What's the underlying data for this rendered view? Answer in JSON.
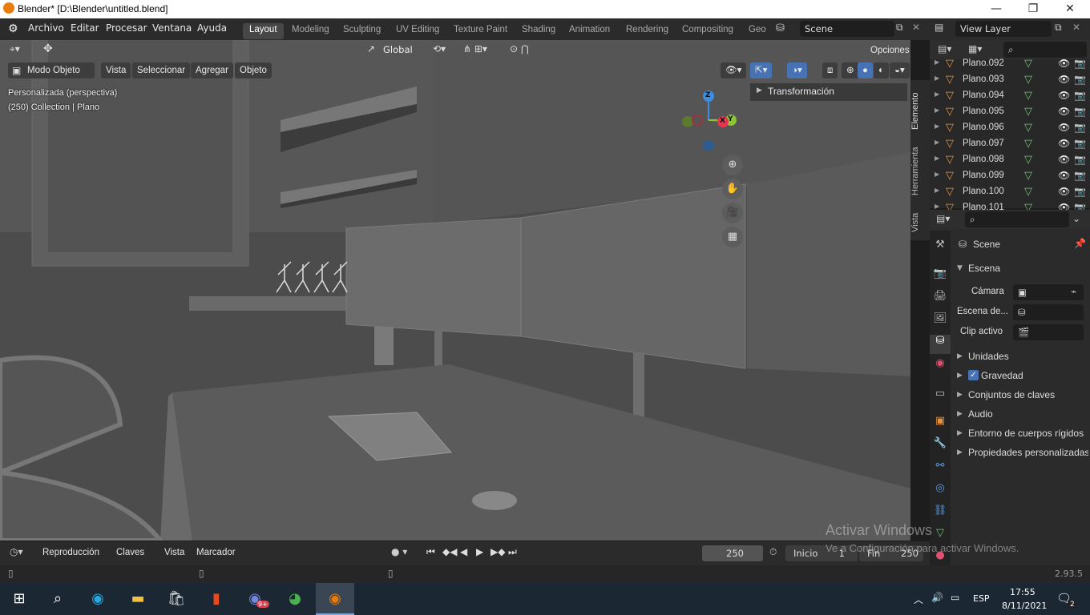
{
  "window": {
    "title": "Blender* [D:\\Blender\\untitled.blend]",
    "minimize": "—",
    "maximize": "❐",
    "close": "✕"
  },
  "menu": {
    "items": [
      "Archivo",
      "Editar",
      "Procesar",
      "Ventana",
      "Ayuda"
    ]
  },
  "workspaces": [
    "Layout",
    "Modeling",
    "Sculpting",
    "UV Editing",
    "Texture Paint",
    "Shading",
    "Animation",
    "Rendering",
    "Compositing",
    "Geo"
  ],
  "scene_field": "Scene",
  "view_layer_field": "View Layer",
  "viewport": {
    "transform_orientation": "Global",
    "options_label": "Opciones",
    "mode": "Modo Objeto",
    "header_menus": [
      "Vista",
      "Seleccionar",
      "Agregar",
      "Objeto"
    ],
    "view_name": "Personalizada (perspectiva)",
    "collection_info": "(250) Collection | Plano",
    "transform_panel": "Transformación",
    "side_tabs": [
      "Elemento",
      "Herramienta",
      "Vista"
    ],
    "gizmo": {
      "z": "Z",
      "x": "X",
      "y": "Y"
    }
  },
  "outliner": {
    "items": [
      "Plano.092",
      "Plano.093",
      "Plano.094",
      "Plano.095",
      "Plano.096",
      "Plano.097",
      "Plano.098",
      "Plano.099",
      "Plano.100",
      "Plano.101"
    ]
  },
  "properties": {
    "header": "Scene",
    "panel": "Escena",
    "camera_label": "Cámara",
    "background_scene_label": "Escena de...",
    "active_clip_label": "Clip activo",
    "sections": [
      "Unidades",
      "Gravedad",
      "Conjuntos de claves",
      "Audio",
      "Entorno de cuerpos rígidos",
      "Propiedades personalizadas"
    ],
    "gravity_checked": true
  },
  "timeline": {
    "menus": [
      "Reproducción",
      "Claves",
      "Vista",
      "Marcador"
    ],
    "current_frame": "250",
    "start_label": "Inicio",
    "start_value": "1",
    "end_label": "Fin",
    "end_value": "250"
  },
  "status": {
    "version": "2.93.5"
  },
  "watermark": {
    "line1": "Activar Windows",
    "line2": "Ve a Configuración para activar Windows."
  },
  "taskbar": {
    "lang": "ESP",
    "time": "17:55",
    "date": "8/11/2021",
    "notifications": "2",
    "discord_badge": "9+"
  },
  "colors": {
    "accent": "#4772b3",
    "object_orange": "#e8923a",
    "mesh_green": "#6cc46c",
    "axis_x": "#e8344f",
    "axis_y": "#8bc53a",
    "axis_z": "#3b8ee0"
  }
}
